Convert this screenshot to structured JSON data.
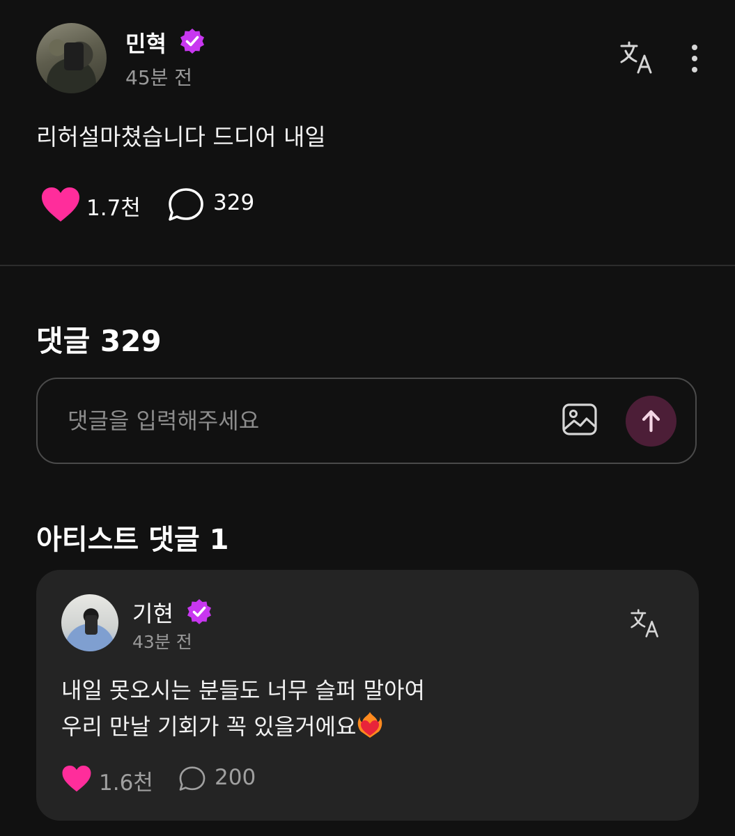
{
  "post": {
    "author": "민혁",
    "time": "45분 전",
    "text": "리허설마쳤습니다 드디어 내일",
    "likes": "1.7천",
    "comments": "329",
    "avatar_icon": "user-avatar",
    "verified_icon": "verified-badge-icon",
    "translate_icon": "translate-icon",
    "more_icon": "more-vertical-icon"
  },
  "comments_section": {
    "header": "댓글 329",
    "input_placeholder": "댓글을 입력해주세요",
    "image_icon": "image-icon",
    "send_icon": "arrow-up-icon"
  },
  "artist_comments": {
    "header": "아티스트 댓글 1",
    "items": [
      {
        "author": "기현",
        "time": "43분 전",
        "text_line1": "내일 못오시는 분들도 너무 슬퍼 말아여",
        "text_line2": "우리 만날 기회가 꼭 있을거에요",
        "emoji": "heart-on-fire-emoji",
        "likes": "1.6천",
        "comments": "200"
      }
    ]
  },
  "colors": {
    "background": "#111111",
    "card": "#242424",
    "accent_pink": "#ff2d9b",
    "verified_purple": "#c837f0",
    "send_button": "#4c1e37",
    "muted_text": "#9a9a9a"
  }
}
